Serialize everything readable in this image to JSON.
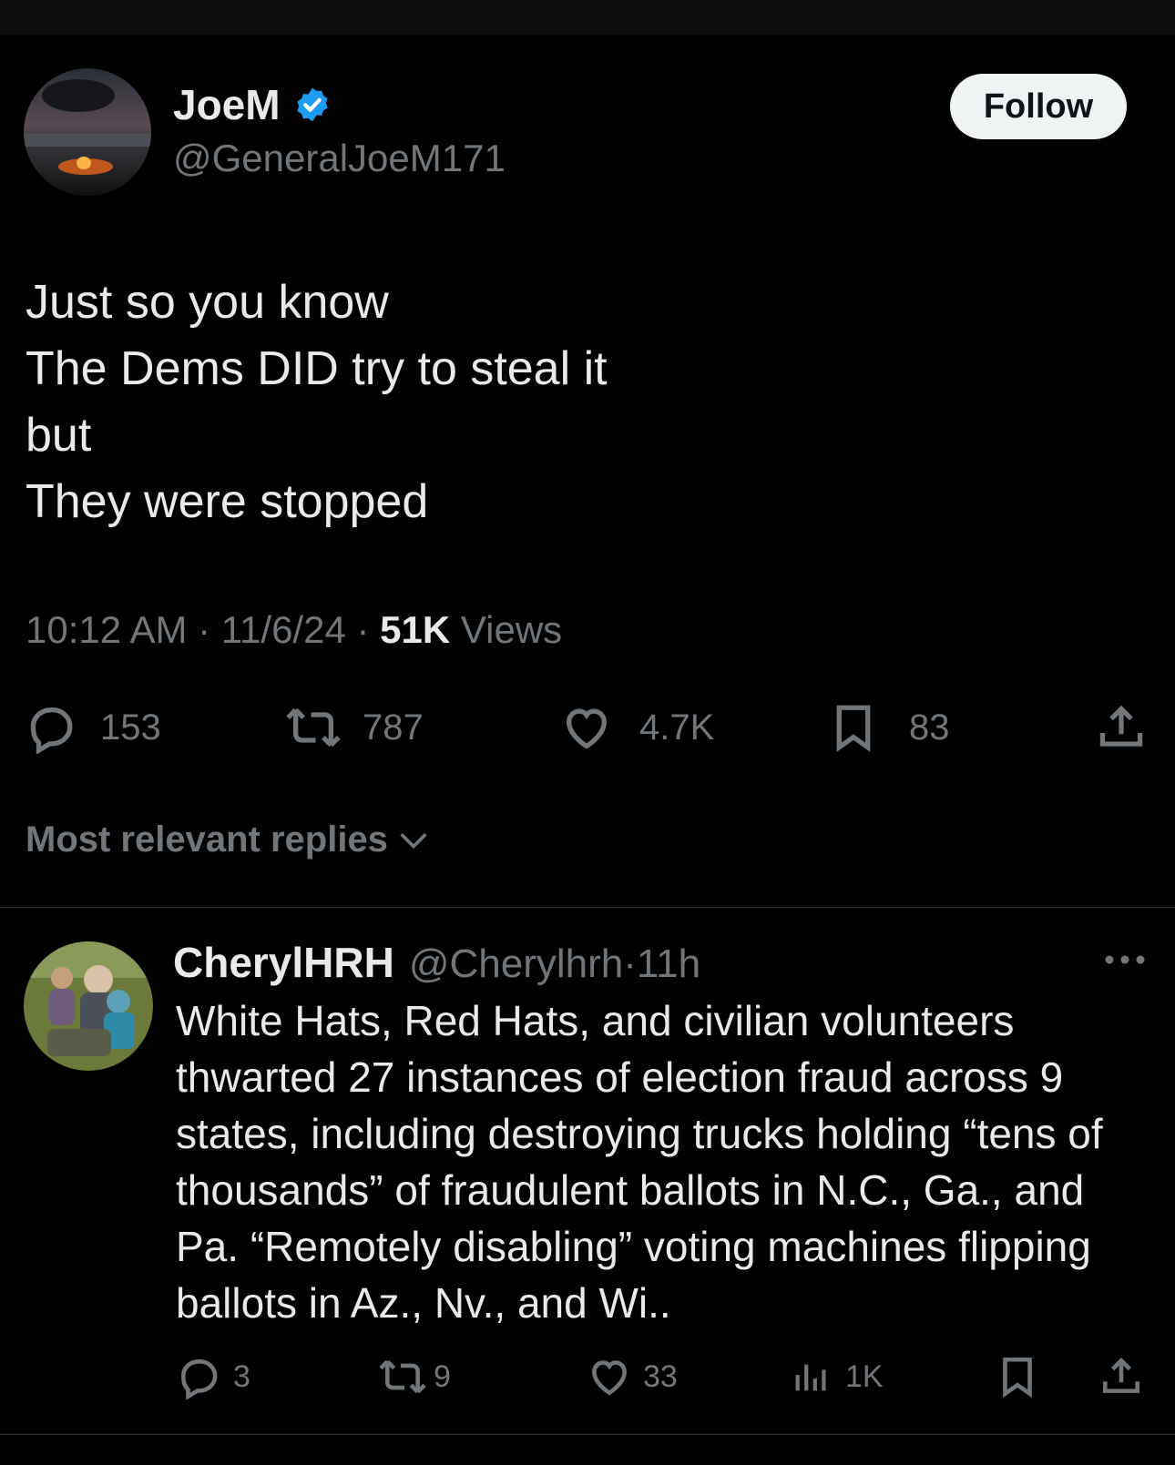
{
  "tweet": {
    "display_name": "JoeM",
    "handle": "@GeneralJoeM171",
    "follow_label": "Follow",
    "text": "Just so you know\nThe Dems DID try to steal it\nbut\nThey were stopped",
    "time": "10:12 AM",
    "date": "11/6/24",
    "views_count": "51K",
    "views_label": "Views",
    "replies": "153",
    "reposts": "787",
    "likes": "4.7K",
    "bookmarks": "83"
  },
  "sort_label": "Most relevant replies",
  "reply": {
    "display_name": "CherylHRH",
    "handle": "@Cherylhrh",
    "age": "11h",
    "text": "White Hats, Red Hats, and civilian volunteers thwarted 27 instances of election fraud across 9 states, including destroying trucks holding “tens of thousands” of fraudulent ballots in N.C., Ga., and Pa. “Remotely disabling” voting machines flipping ballots in Az., Nv., and Wi..",
    "replies": "3",
    "reposts": "9",
    "likes": "33",
    "views": "1K"
  },
  "colors": {
    "background": "#000000",
    "text": "#e7e9ea",
    "muted": "#71767b",
    "verified": "#1d9bf0"
  }
}
